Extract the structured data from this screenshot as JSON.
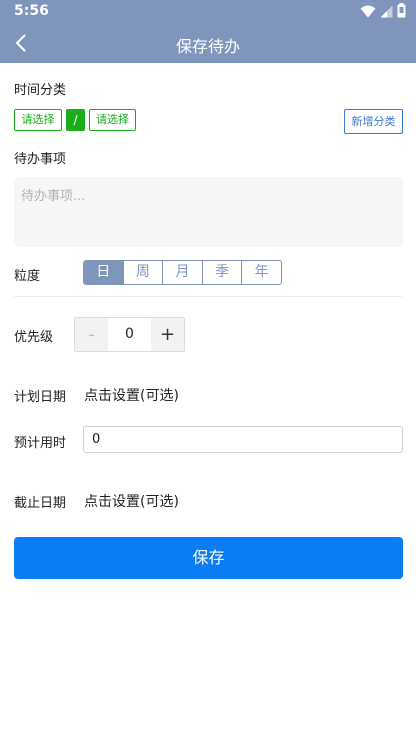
{
  "status_bar": {
    "time": "5:56",
    "icons": [
      "wifi-icon",
      "signal-icon",
      "battery-icon"
    ]
  },
  "navbar": {
    "title": "保存待办",
    "back_icon": "chevron-left-icon"
  },
  "category": {
    "label": "时间分类",
    "select_1": "请选择",
    "separator": "/",
    "select_2": "请选择",
    "new_button": "新增分类"
  },
  "todo": {
    "label": "待办事项",
    "placeholder": "待办事项..."
  },
  "granularity": {
    "label": "粒度",
    "options": [
      "日",
      "周",
      "月",
      "季",
      "年"
    ],
    "selected": "日"
  },
  "priority": {
    "label": "优先级",
    "minus": "-",
    "value": "0",
    "plus": "+"
  },
  "planned_date": {
    "label": "计划日期",
    "value": "点击设置(可选)"
  },
  "estimated_time": {
    "label": "预计用时",
    "value": "0"
  },
  "deadline": {
    "label": "截止日期",
    "value": "点击设置(可选)"
  },
  "save_button": "保存",
  "colors": {
    "header": "#7f95bb",
    "chip_green": "#1aad19",
    "link_blue": "#3a7bd5",
    "primary": "#0a7cf4"
  }
}
